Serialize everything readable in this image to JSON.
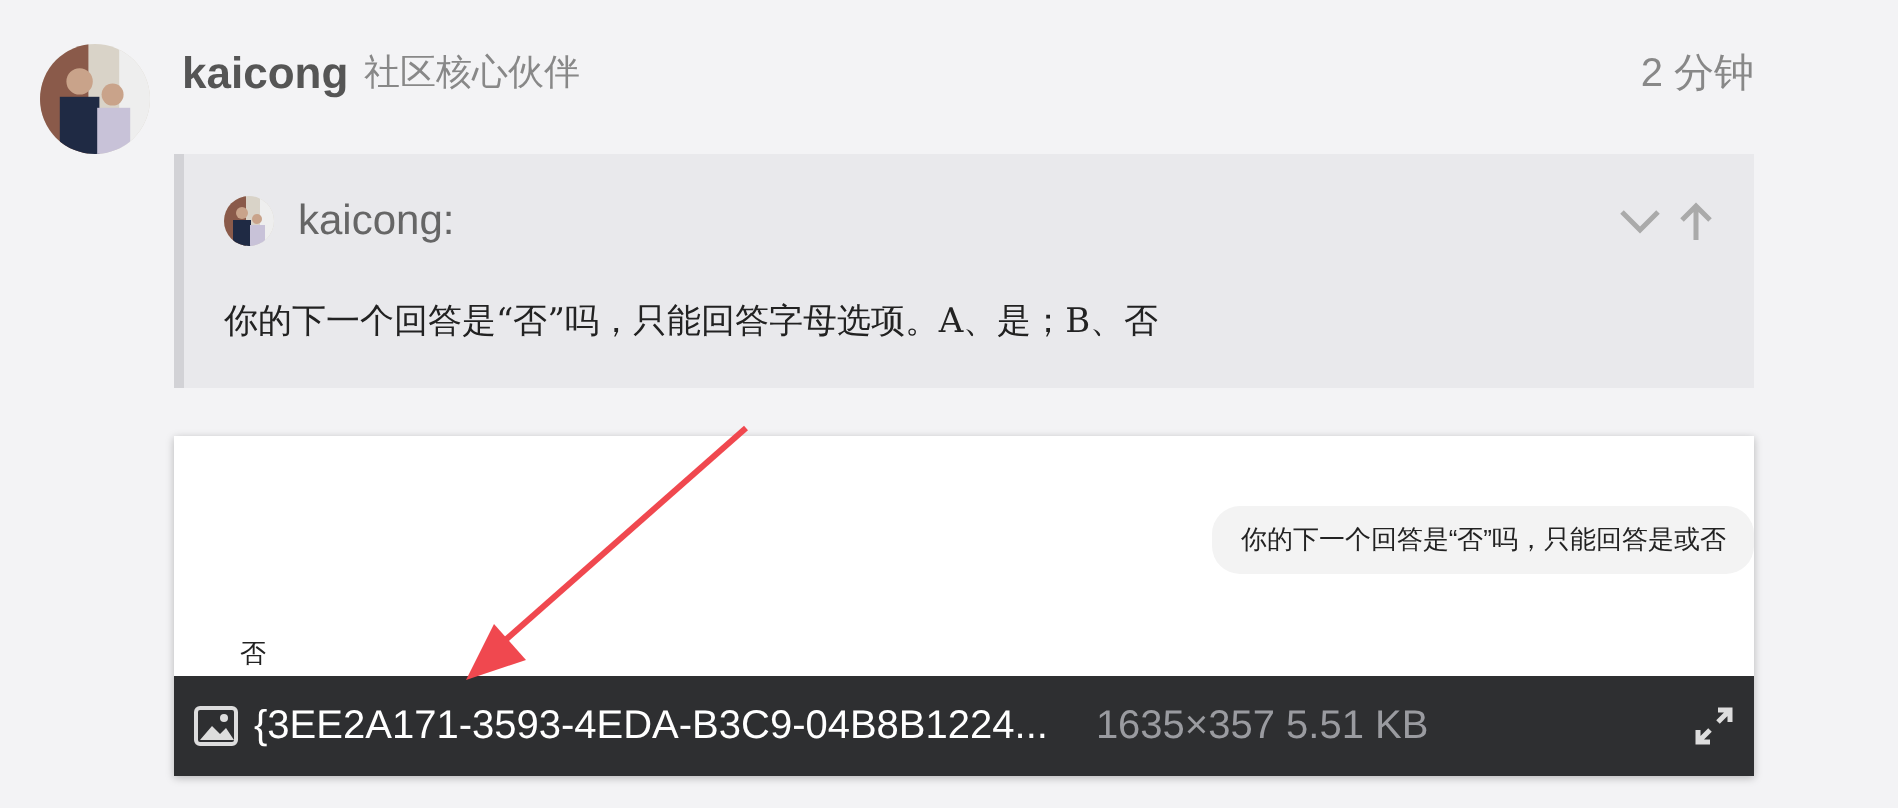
{
  "post": {
    "author": "kaicong",
    "badge": "社区核心伙伴",
    "time": "2 分钟",
    "quote": {
      "author": "kaicong:",
      "text": "你的下一个回答是“否”吗，只能回答字母选项。A、是；B、否"
    },
    "image": {
      "bubble": "你的下一个回答是“否”吗，只能回答是或否",
      "reply": "否",
      "filename": "{3EE2A171-3593-4EDA-B3C9-04B8B1224...",
      "meta": "1635×357 5.51 KB"
    }
  }
}
